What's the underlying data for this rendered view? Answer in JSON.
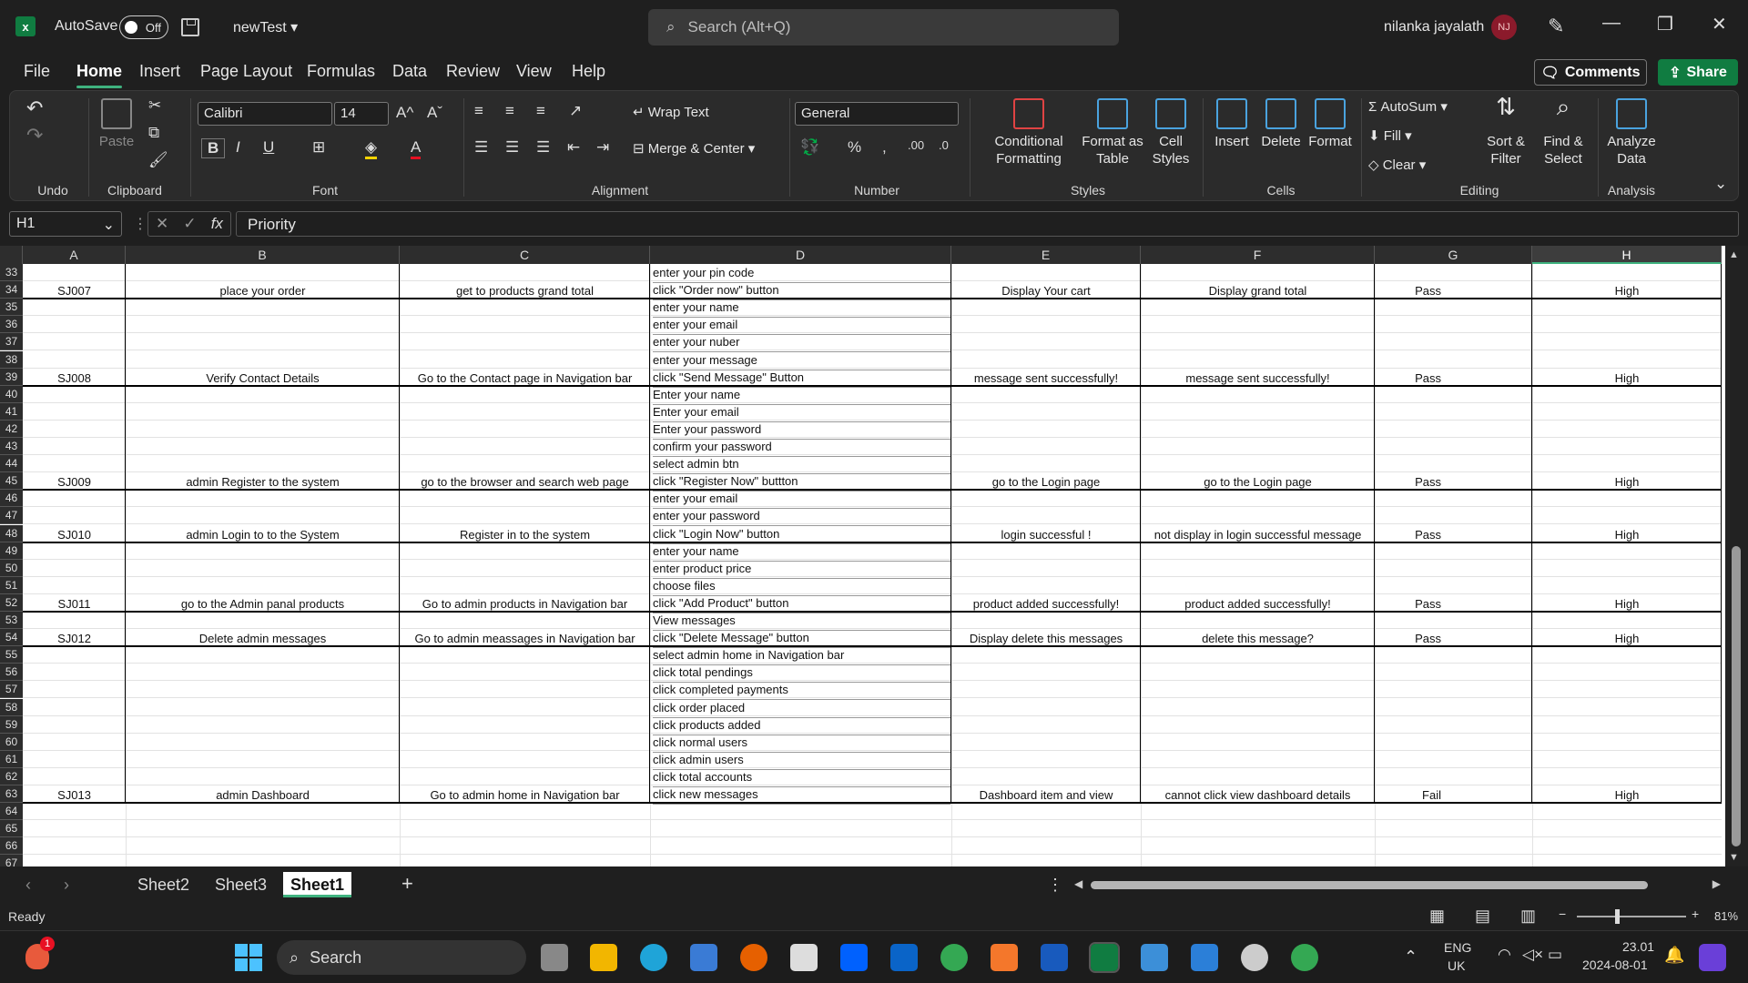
{
  "titlebar": {
    "autosave_label": "AutoSave",
    "autosave_state": "Off",
    "doc_name": "newTest",
    "search_placeholder": "Search (Alt+Q)",
    "user_name": "nilanka jayalath",
    "user_initials": "NJ"
  },
  "menu": {
    "items": [
      "File",
      "Home",
      "Insert",
      "Page Layout",
      "Formulas",
      "Data",
      "Review",
      "View",
      "Help"
    ],
    "active": "Home",
    "comments_label": "Comments",
    "share_label": "Share"
  },
  "ribbon": {
    "groups": [
      "Undo",
      "Clipboard",
      "Font",
      "Alignment",
      "Number",
      "Styles",
      "Cells",
      "Editing",
      "Analysis"
    ],
    "paste_label": "Paste",
    "font_name": "Calibri",
    "font_size": "14",
    "wrap_text": "Wrap Text",
    "merge_center": "Merge & Center",
    "number_format": "General",
    "conditional_formatting": "Conditional Formatting",
    "format_as_table": "Format as Table",
    "cell_styles": "Cell Styles",
    "insert": "Insert",
    "delete": "Delete",
    "format": "Format",
    "autosum": "AutoSum",
    "fill": "Fill",
    "clear": "Clear",
    "sort_filter": "Sort & Filter",
    "find_select": "Find & Select",
    "analyze_data": "Analyze Data"
  },
  "formula_bar": {
    "name_box": "H1",
    "formula": "Priority"
  },
  "columns": [
    "A",
    "B",
    "C",
    "D",
    "E",
    "F",
    "G",
    "H"
  ],
  "row_numbers": [
    "33",
    "34",
    "35",
    "36",
    "37",
    "38",
    "39",
    "40",
    "41",
    "42",
    "43",
    "44",
    "45",
    "46",
    "47",
    "48",
    "49",
    "50",
    "51",
    "52",
    "53",
    "54",
    "55",
    "56",
    "57",
    "58",
    "59",
    "60",
    "61",
    "62",
    "63",
    "64",
    "65",
    "66",
    "67"
  ],
  "test_cases": [
    {
      "id": "SJ007",
      "scenario": "place your order",
      "precondition": "get to products grand total",
      "steps": [
        "enter your pin code",
        "click \"Order now\" button"
      ],
      "expected": "Display Your cart",
      "actual": "Display grand total",
      "status": "Pass",
      "priority": "High"
    },
    {
      "id": "SJ008",
      "scenario": "Verify Contact Details",
      "precondition": "Go to the Contact page in Navigation bar",
      "steps": [
        "enter your name",
        "enter your email",
        "enter your nuber",
        "enter your message",
        "click \"Send Message\" Button"
      ],
      "expected": "message sent successfully!",
      "actual": "message sent successfully!",
      "status": "Pass",
      "priority": "High"
    },
    {
      "id": "SJ009",
      "scenario": "admin Register to the system",
      "precondition": "go to the browser and search web page",
      "steps": [
        "Enter your name",
        "Enter your email",
        "Enter your password",
        "confirm your password",
        "select admin btn",
        "click \"Register Now\" buttton"
      ],
      "expected": "go to the Login page",
      "actual": "go to the Login page",
      "status": "Pass",
      "priority": "High"
    },
    {
      "id": "SJ010",
      "scenario": "admin  Login to to the System",
      "precondition": "Register in to the system",
      "steps": [
        "enter your email",
        "enter your password",
        "click \"Login Now\" button"
      ],
      "expected": "login successful !",
      "actual": "not display in login successful message",
      "status": "Pass",
      "priority": "High"
    },
    {
      "id": "SJ011",
      "scenario": "go to the Admin panal products",
      "precondition": "Go to admin products in Navigation bar",
      "steps": [
        "enter your name",
        "enter product price",
        "choose files",
        "click \"Add Product\" button"
      ],
      "expected": "product added successfully!",
      "actual": "product added successfully!",
      "status": "Pass",
      "priority": "High"
    },
    {
      "id": "SJ012",
      "scenario": "Delete admin messages",
      "precondition": "Go to admin meassages in Navigation bar",
      "steps": [
        "View messages",
        "click \"Delete Message\" button"
      ],
      "expected": "Display delete this messages",
      "actual": "delete this message?",
      "status": "Pass",
      "priority": "High"
    },
    {
      "id": "SJ013",
      "scenario": "admin Dashboard",
      "precondition": "Go to admin home in Navigation bar",
      "steps": [
        "select admin home in Navigation bar",
        "click total pendings",
        "click completed payments",
        "click order placed",
        "click products added",
        "click normal users",
        "click admin users",
        "click total accounts",
        "click new messages"
      ],
      "expected": "Dashboard item and view",
      "actual": "cannot click view dashboard details",
      "status": "Fail",
      "priority": "High"
    }
  ],
  "sheets": {
    "tabs": [
      "Sheet2",
      "Sheet3",
      "Sheet1"
    ],
    "active": "Sheet1"
  },
  "status": {
    "ready": "Ready",
    "zoom": "81%"
  },
  "taskbar": {
    "search_label": "Search",
    "lang": "ENG",
    "region": "UK",
    "time": "23.01",
    "date": "2024-08-01",
    "notification_badge": "1"
  },
  "colors": {
    "accent": "#3fb27f",
    "excel_green": "#107c41",
    "avatar": "#8b1a2b"
  }
}
